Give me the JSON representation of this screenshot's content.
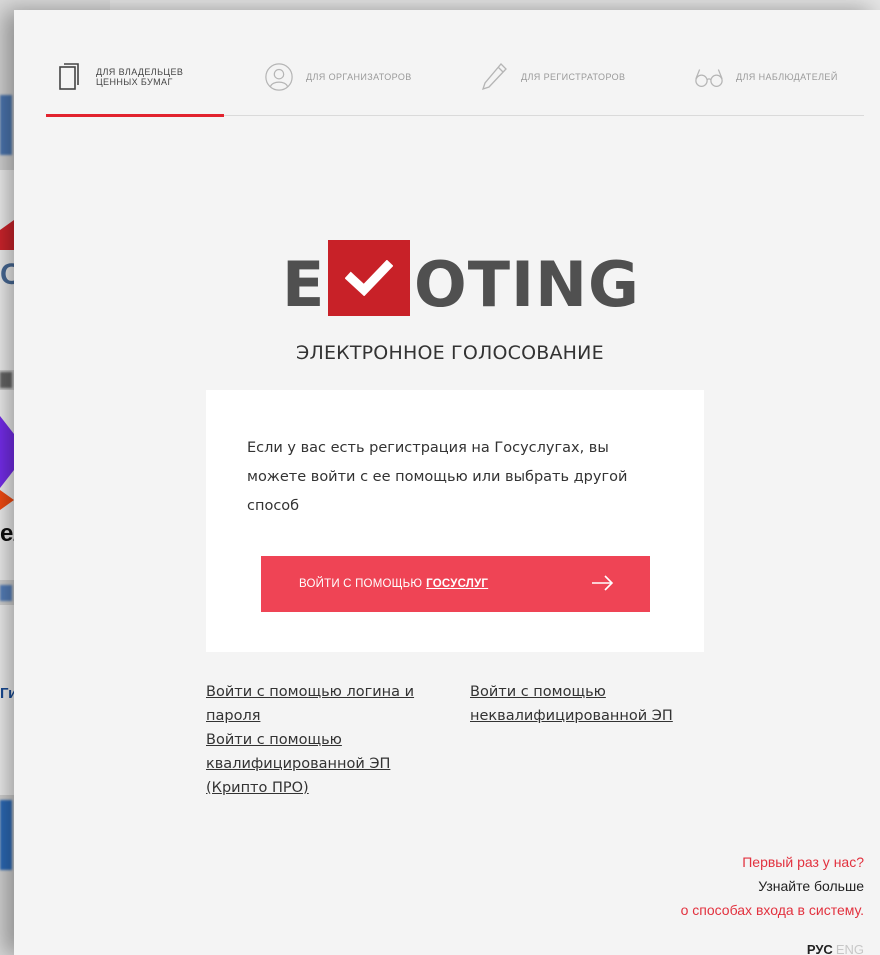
{
  "tabs": [
    {
      "label": "ДЛЯ ВЛАДЕЛЬЦЕВ\nЦЕННЫХ БУМАГ",
      "icon": "document-icon",
      "active": true
    },
    {
      "label": "ДЛЯ ОРГАНИЗАТОРОВ",
      "icon": "user-circle-icon",
      "active": false
    },
    {
      "label": "ДЛЯ РЕГИСТРАТОРОВ",
      "icon": "pencil-icon",
      "active": false
    },
    {
      "label": "ДЛЯ НАБЛЮДАТЕЛЕЙ",
      "icon": "glasses-icon",
      "active": false
    }
  ],
  "logo": {
    "left": "E",
    "right": "OTING",
    "subtitle": "ЭЛЕКТРОННОЕ ГОЛОСОВАНИЕ",
    "accent": "#c82128"
  },
  "card": {
    "text": "Если у вас есть регистрация на Госуслугах, вы можете войти с ее помощью или выбрать другой способ",
    "button_prefix": "ВОЙТИ С ПОМОЩЬЮ",
    "button_strong": "ГОСУСЛУГ",
    "button_color": "#ef4455"
  },
  "alt_links": {
    "login": "Войти с помощью логина и пароля",
    "qualified": "Войти с помощью квалифицированной ЭП (Крипто ПРО)",
    "unqualified": "Войти с помощью неквалифицированной ЭП"
  },
  "help": {
    "line1": "Первый раз у нас?",
    "line2": "Узнайте больше",
    "line3": "о способах входа в систему."
  },
  "lang": {
    "ru": "РУС",
    "en": "ENG"
  },
  "background": {
    "logo1": "ОСА",
    "logo2": "елеком",
    "logo3": "Гидро"
  }
}
